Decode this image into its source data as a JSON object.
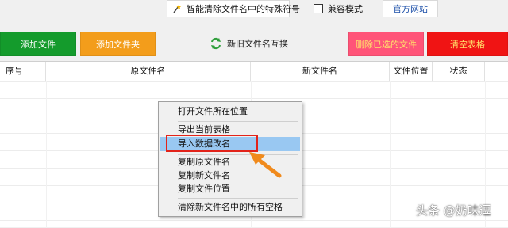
{
  "topbar": {
    "feature_label": "智能清除文件名中的特殊符号",
    "compat_label": "兼容模式",
    "site_label": "官方网站"
  },
  "toolbar": {
    "add_file": "添加文件",
    "add_folder": "添加文件夹",
    "swap_names": "新旧文件名互换",
    "delete_selected": "删除已选的文件",
    "clear_table": "清空表格"
  },
  "table": {
    "headers": [
      "序号",
      "原文件名",
      "新文件名",
      "文件位置",
      "状态"
    ]
  },
  "context_menu": {
    "items": [
      "打开文件所在位置",
      "导出当前表格",
      "导入数据改名",
      "复制原文件名",
      "复制新文件名",
      "复制文件位置",
      "清除新文件名中的所有空格"
    ],
    "highlighted": "导入数据改名"
  },
  "watermark": "头条 @奶味逗",
  "colors": {
    "add_file": "#149b2c",
    "add_folder": "#f39d1b",
    "delete_selected": "#ff5478",
    "clear_table": "#f01414",
    "highlight": "#99c8f2",
    "annotation": "#e2231a",
    "arrow": "#f08a1c"
  }
}
